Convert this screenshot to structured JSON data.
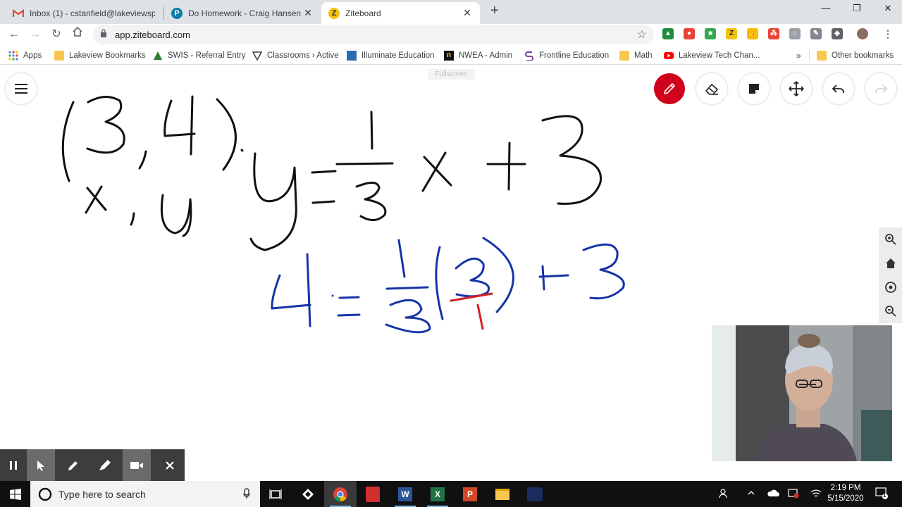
{
  "browser": {
    "tabs": [
      {
        "title": "Inbox (1) - cstanfield@lakeviewsp",
        "icon": "gmail-icon",
        "active": false
      },
      {
        "title": "Do Homework - Craig Hansen",
        "icon": "pearson-icon",
        "active": false
      },
      {
        "title": "Ziteboard",
        "icon": "ziteboard-icon",
        "active": true
      }
    ],
    "new_tab_label": "+",
    "url": "app.ziteboard.com",
    "bookmarks": [
      {
        "label": "Apps",
        "icon": "apps-grid-icon"
      },
      {
        "label": "Lakeview Bookmarks",
        "icon": "folder-icon"
      },
      {
        "label": "SWIS - Referral Entry",
        "icon": "swis-icon"
      },
      {
        "label": "Classrooms › Active",
        "icon": "classrooms-icon"
      },
      {
        "label": "Illuminate Education",
        "icon": "illuminate-icon"
      },
      {
        "label": "NWEA - Admin",
        "icon": "nwea-icon"
      },
      {
        "label": "Frontline Education",
        "icon": "frontline-icon"
      },
      {
        "label": "Math",
        "icon": "folder-icon"
      },
      {
        "label": "Lakeview Tech Chan...",
        "icon": "youtube-icon"
      }
    ],
    "overflow_label": "»",
    "other_bookmarks": "Other bookmarks"
  },
  "ziteboard": {
    "fullscreen_label": "Fullscreen",
    "tools": [
      "pen-tool",
      "eraser-tool",
      "sticky-note-tool",
      "pan-tool",
      "undo",
      "redo"
    ],
    "active_tool": "pen-tool",
    "accent_color": "#d0021b",
    "ink_colors": {
      "black": "#111111",
      "blue": "#1633a8",
      "red": "#d61f26"
    }
  },
  "taskbar": {
    "search_placeholder": "Type here to search",
    "time": "2:19 PM",
    "date": "5/15/2020",
    "notification_count": "1"
  }
}
